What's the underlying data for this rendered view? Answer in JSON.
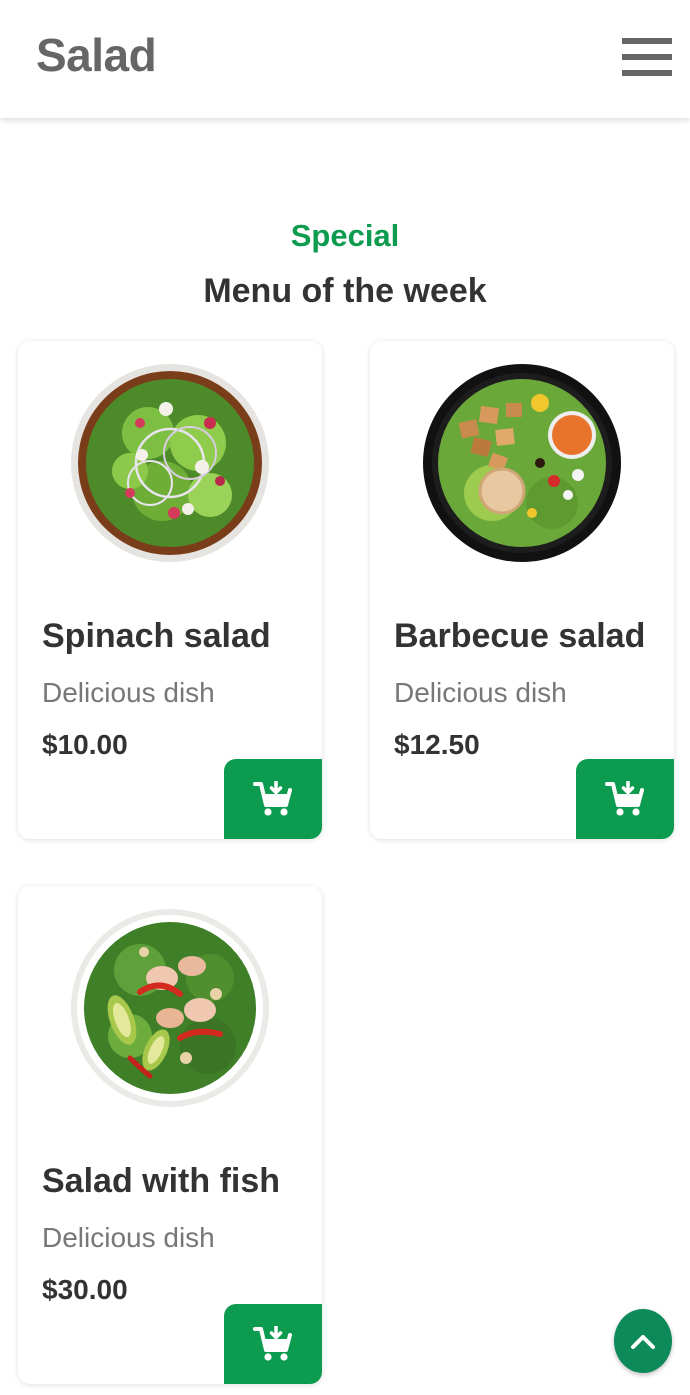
{
  "header": {
    "logo": "Salad",
    "menu_icon": "hamburger-menu-icon"
  },
  "section": {
    "subtitle": "Special",
    "title": "Menu of the week"
  },
  "products": [
    {
      "name": "Spinach salad",
      "description": "Delicious dish",
      "price": "$10.00",
      "image": "spinach-salad-bowl"
    },
    {
      "name": "Barbecue salad",
      "description": "Delicious dish",
      "price": "$12.50",
      "image": "barbecue-salad-bowl"
    },
    {
      "name": "Salad with fish",
      "description": "Delicious dish",
      "price": "$30.00",
      "image": "fish-salad-bowl"
    }
  ],
  "icons": {
    "cart": "add-to-cart-icon",
    "scroll_top": "chevron-up-icon"
  },
  "colors": {
    "accent": "#0d9b4f",
    "scroll_top": "#0d8a5a",
    "logo": "#666666"
  }
}
